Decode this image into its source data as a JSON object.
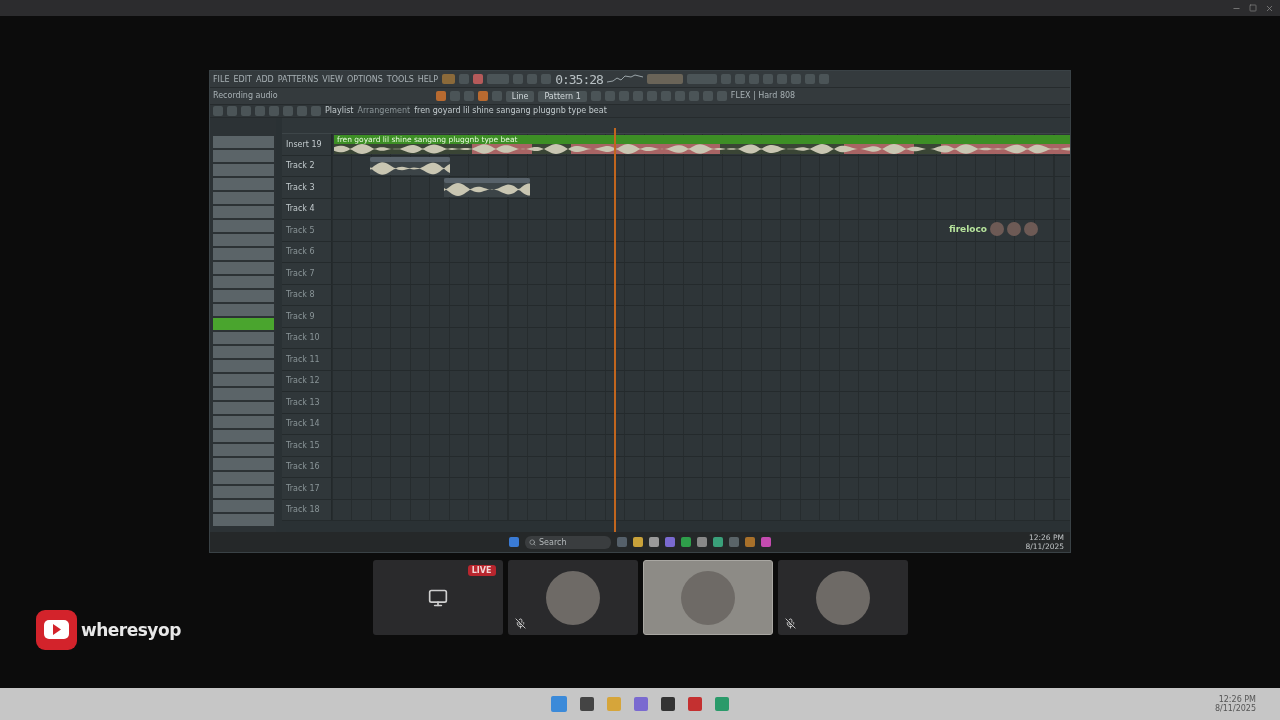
{
  "shared_screen": {
    "menu": [
      "FILE",
      "EDIT",
      "ADD",
      "PATTERNS",
      "VIEW",
      "OPTIONS",
      "TOOLS",
      "HELP"
    ],
    "time": "0:35:28",
    "hint": "Recording audio",
    "snap": "Line",
    "pattern": "Pattern 1",
    "preset": "FLEX | Hard 808",
    "playlist_title": "Playlist",
    "arrangement": "Arrangement",
    "breadcrumb": "fren goyard lil shine sangang pluggnb type beat",
    "browser_items": [
      {
        "selected": false
      },
      {
        "selected": false
      },
      {
        "selected": false
      },
      {
        "selected": false
      },
      {
        "selected": false
      },
      {
        "selected": false
      },
      {
        "selected": false
      },
      {
        "selected": false
      },
      {
        "selected": false
      },
      {
        "selected": false
      },
      {
        "selected": false
      },
      {
        "selected": false
      },
      {
        "selected": false
      },
      {
        "selected": true
      },
      {
        "selected": false
      },
      {
        "selected": false
      },
      {
        "selected": false
      },
      {
        "selected": false
      },
      {
        "selected": false
      },
      {
        "selected": false
      },
      {
        "selected": false
      },
      {
        "selected": false
      },
      {
        "selected": false
      },
      {
        "selected": false
      },
      {
        "selected": false
      },
      {
        "selected": false
      },
      {
        "selected": false
      },
      {
        "selected": false
      }
    ],
    "tracks": [
      {
        "name": "Insert 19",
        "empty": false,
        "clip": {
          "kind": "beat",
          "label": "fren goyard lil shine sangang pluggnb type beat"
        }
      },
      {
        "name": "Track 2",
        "empty": false,
        "clip": {
          "kind": "vocal"
        }
      },
      {
        "name": "Track 3",
        "empty": false,
        "clip": {
          "kind": "vocal"
        }
      },
      {
        "name": "Track 4",
        "empty": false
      },
      {
        "name": "Track 5",
        "empty": true
      },
      {
        "name": "Track 6",
        "empty": true
      },
      {
        "name": "Track 7",
        "empty": true
      },
      {
        "name": "Track 8",
        "empty": true
      },
      {
        "name": "Track 9",
        "empty": true
      },
      {
        "name": "Track 10",
        "empty": true
      },
      {
        "name": "Track 11",
        "empty": true
      },
      {
        "name": "Track 12",
        "empty": true
      },
      {
        "name": "Track 13",
        "empty": true
      },
      {
        "name": "Track 14",
        "empty": true
      },
      {
        "name": "Track 15",
        "empty": true
      },
      {
        "name": "Track 16",
        "empty": true
      },
      {
        "name": "Track 17",
        "empty": true
      },
      {
        "name": "Track 18",
        "empty": true
      }
    ],
    "overlay_name": "fireloco",
    "taskbar": {
      "search_placeholder": "Search",
      "time": "12:26 PM",
      "date": "8/11/2025"
    }
  },
  "participants": [
    {
      "kind": "screen",
      "badge": "LIVE",
      "muted": false,
      "speaking": false
    },
    {
      "kind": "avatar",
      "muted": true,
      "speaking": false
    },
    {
      "kind": "avatar",
      "muted": false,
      "speaking": true
    },
    {
      "kind": "avatar",
      "muted": true,
      "speaking": false
    }
  ],
  "channel": {
    "name": "wheresyop"
  },
  "taskbar": {
    "time": "12:26 PM",
    "date": "8/11/2025"
  }
}
